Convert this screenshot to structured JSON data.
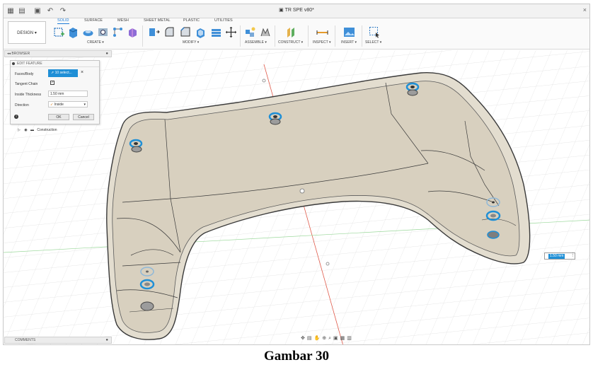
{
  "window": {
    "title": "TR SPE v80*"
  },
  "workspace": {
    "label": "DESIGN"
  },
  "tabs": [
    {
      "label": "SOLID",
      "active": true
    },
    {
      "label": "SURFACE",
      "active": false
    },
    {
      "label": "MESH",
      "active": false
    },
    {
      "label": "SHEET METAL",
      "active": false
    },
    {
      "label": "PLASTIC",
      "active": false
    },
    {
      "label": "UTILITIES",
      "active": false
    }
  ],
  "groups": {
    "create": "CREATE",
    "modify": "MODIFY",
    "assemble": "ASSEMBLE",
    "construct": "CONSTRUCT",
    "inspect": "INSPECT",
    "insert": "INSERT",
    "select": "SELECT"
  },
  "browser": {
    "title": "BROWSER",
    "construction": "Construction"
  },
  "dialog": {
    "title": "EDIT FEATURE",
    "faces_label": "Faces/Body",
    "faces_value": "10 select...",
    "tangent_label": "Tangent Chain",
    "tangent_checked": true,
    "thickness_label": "Inside Thickness",
    "thickness_value": "1.50 mm",
    "direction_label": "Direction",
    "direction_value": "Inside",
    "ok": "OK",
    "cancel": "Cancel"
  },
  "comments": {
    "title": "COMMENTS"
  },
  "viewport": {
    "thickness_input": "1.50 mm"
  },
  "caption": "Gambar 30",
  "colors": {
    "accent": "#1f8fd6",
    "shell_fill": "#e3ddcf",
    "shell_edge": "#3a3a3a",
    "axis_red": "#e05a4a",
    "axis_green": "#7dd07d"
  }
}
